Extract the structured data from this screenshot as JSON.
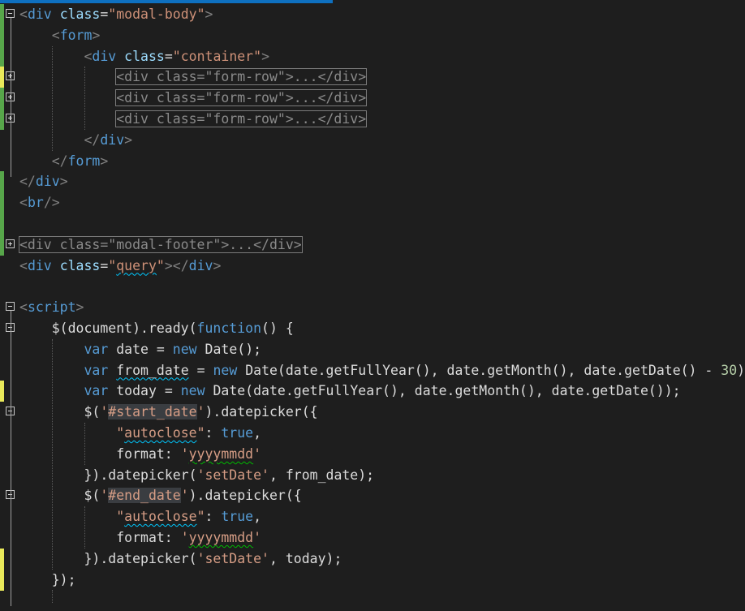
{
  "editor": {
    "lines": [
      {
        "tokens": [
          [
            "tag",
            "<"
          ],
          [
            "tn",
            "div"
          ],
          [
            "pl",
            " "
          ],
          [
            "at",
            "class"
          ],
          [
            "pl",
            "="
          ],
          [
            "av",
            "\"modal-body\""
          ],
          [
            "tag",
            ">"
          ]
        ]
      },
      {
        "tokens": [
          [
            "pl",
            "    "
          ],
          [
            "tag",
            "<"
          ],
          [
            "tn",
            "form"
          ],
          [
            "tag",
            ">"
          ]
        ]
      },
      {
        "tokens": [
          [
            "pl",
            "        "
          ],
          [
            "tag",
            "<"
          ],
          [
            "tn",
            "div"
          ],
          [
            "pl",
            " "
          ],
          [
            "at",
            "class"
          ],
          [
            "pl",
            "="
          ],
          [
            "av",
            "\"container\""
          ],
          [
            "tag",
            ">"
          ]
        ]
      },
      {
        "tokens": [
          [
            "pl",
            "            "
          ],
          [
            "collapsed",
            "<div class=\"form-row\">...</div>"
          ]
        ]
      },
      {
        "tokens": [
          [
            "pl",
            "            "
          ],
          [
            "collapsed",
            "<div class=\"form-row\">...</div>"
          ]
        ]
      },
      {
        "tokens": [
          [
            "pl",
            "            "
          ],
          [
            "collapsed",
            "<div class=\"form-row\">...</div>"
          ]
        ]
      },
      {
        "tokens": [
          [
            "pl",
            "        "
          ],
          [
            "tag",
            "</"
          ],
          [
            "tn",
            "div"
          ],
          [
            "tag",
            ">"
          ]
        ]
      },
      {
        "tokens": [
          [
            "pl",
            "    "
          ],
          [
            "tag",
            "</"
          ],
          [
            "tn",
            "form"
          ],
          [
            "tag",
            ">"
          ]
        ]
      },
      {
        "tokens": [
          [
            "tag",
            "</"
          ],
          [
            "tn",
            "div"
          ],
          [
            "tag",
            ">"
          ]
        ]
      },
      {
        "tokens": [
          [
            "tag",
            "<"
          ],
          [
            "tn",
            "br"
          ],
          [
            "tag",
            "/>"
          ]
        ]
      },
      {
        "tokens": []
      },
      {
        "tokens": [
          [
            "collapsed",
            "<div class=\"modal-footer\">...</div>"
          ]
        ]
      },
      {
        "tokens": [
          [
            "tag",
            "<"
          ],
          [
            "tn",
            "div"
          ],
          [
            "pl",
            " "
          ],
          [
            "at",
            "class"
          ],
          [
            "pl",
            "="
          ],
          [
            "av",
            "\""
          ],
          [
            "avsq",
            "query"
          ],
          [
            "av",
            "\""
          ],
          [
            "tag",
            "></"
          ],
          [
            "tn",
            "div"
          ],
          [
            "tag",
            ">"
          ]
        ]
      },
      {
        "tokens": []
      },
      {
        "tokens": [
          [
            "tag",
            "<"
          ],
          [
            "tn",
            "script"
          ],
          [
            "tag",
            ">"
          ]
        ]
      },
      {
        "tokens": [
          [
            "pl",
            "    $(document).ready("
          ],
          [
            "kw",
            "function"
          ],
          [
            "pl",
            "() {"
          ]
        ]
      },
      {
        "tokens": [
          [
            "pl",
            "        "
          ],
          [
            "kw",
            "var"
          ],
          [
            "pl",
            " date = "
          ],
          [
            "kw",
            "new"
          ],
          [
            "pl",
            " Date();"
          ]
        ]
      },
      {
        "tokens": [
          [
            "pl",
            "        "
          ],
          [
            "kw",
            "var"
          ],
          [
            "pl",
            " "
          ],
          [
            "plsq",
            "from_date"
          ],
          [
            "pl",
            " = "
          ],
          [
            "kw",
            "new"
          ],
          [
            "pl",
            " Date(date.getFullYear(), date.getMonth(), date.getDate() - "
          ],
          [
            "nu",
            "30"
          ],
          [
            "pl",
            ");"
          ]
        ]
      },
      {
        "tokens": [
          [
            "pl",
            "        "
          ],
          [
            "kw",
            "var"
          ],
          [
            "pl",
            " today = "
          ],
          [
            "kw",
            "new"
          ],
          [
            "pl",
            " Date(date.getFullYear(), date.getMonth(), date.getDate());"
          ]
        ]
      },
      {
        "tokens": [
          [
            "pl",
            "        $("
          ],
          [
            "st",
            "'"
          ],
          [
            "sthl",
            "#start_date"
          ],
          [
            "st",
            "'"
          ],
          [
            "pl",
            ").datepicker({"
          ]
        ]
      },
      {
        "tokens": [
          [
            "pl",
            "            "
          ],
          [
            "st",
            "\""
          ],
          [
            "stsq",
            "autoclose"
          ],
          [
            "st",
            "\""
          ],
          [
            "pl",
            ": "
          ],
          [
            "kw",
            "true"
          ],
          [
            "pl",
            ","
          ]
        ]
      },
      {
        "tokens": [
          [
            "pl",
            "            format: "
          ],
          [
            "st",
            "'"
          ],
          [
            "stsqg",
            "yyyymmdd"
          ],
          [
            "st",
            "'"
          ]
        ]
      },
      {
        "tokens": [
          [
            "pl",
            "        })."
          ],
          [
            "pl",
            "datepicker("
          ],
          [
            "st",
            "'setDate'"
          ],
          [
            "pl",
            ", from_date);"
          ]
        ]
      },
      {
        "tokens": [
          [
            "pl",
            "        $("
          ],
          [
            "st",
            "'"
          ],
          [
            "sthl",
            "#end_date"
          ],
          [
            "st",
            "'"
          ],
          [
            "pl",
            ").datepicker({"
          ]
        ]
      },
      {
        "tokens": [
          [
            "pl",
            "            "
          ],
          [
            "st",
            "\""
          ],
          [
            "stsq",
            "autoclose"
          ],
          [
            "st",
            "\""
          ],
          [
            "pl",
            ": "
          ],
          [
            "kw",
            "true"
          ],
          [
            "pl",
            ","
          ]
        ]
      },
      {
        "tokens": [
          [
            "pl",
            "            format: "
          ],
          [
            "st",
            "'"
          ],
          [
            "stsqg",
            "yyyymmdd"
          ],
          [
            "st",
            "'"
          ]
        ]
      },
      {
        "tokens": [
          [
            "pl",
            "        })."
          ],
          [
            "pl",
            "datepicker("
          ],
          [
            "st",
            "'setDate'"
          ],
          [
            "pl",
            ", today);"
          ]
        ]
      },
      {
        "tokens": [
          [
            "pl",
            "    });"
          ]
        ]
      },
      {
        "tokens": []
      }
    ]
  }
}
